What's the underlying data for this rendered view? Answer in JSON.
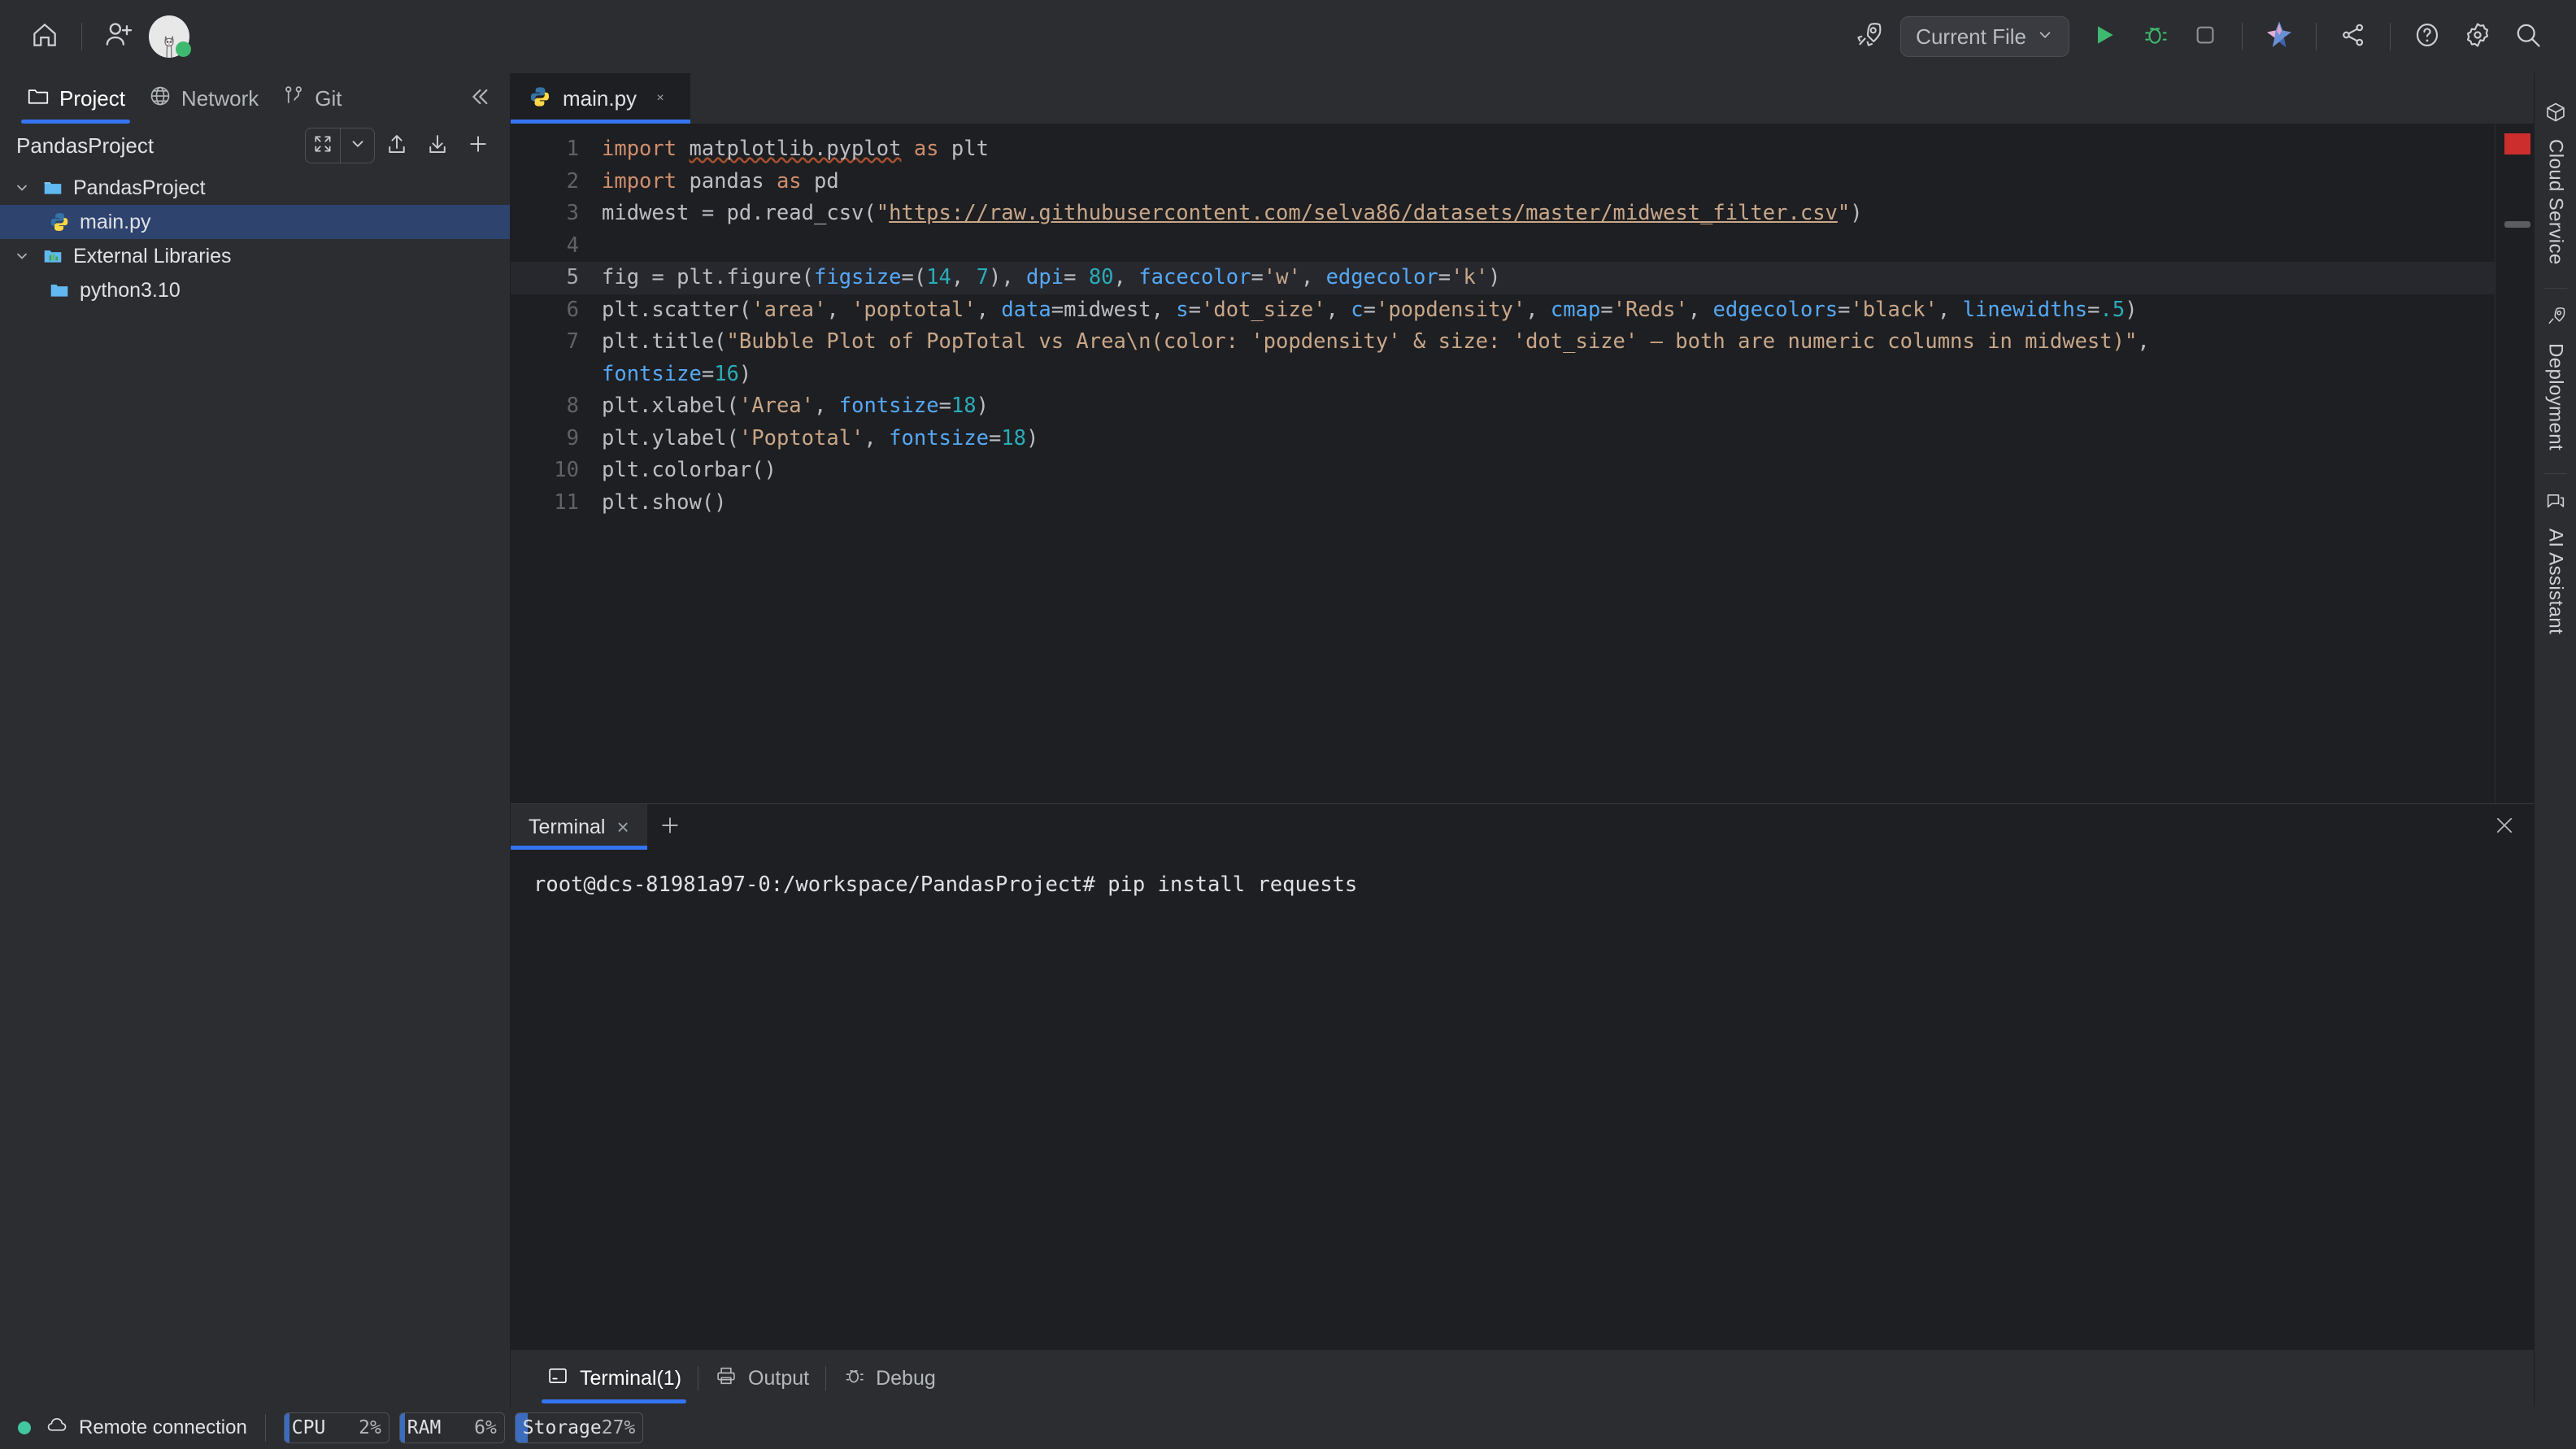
{
  "toolbar": {
    "home_icon": "home-icon",
    "add_user_icon": "add-user-icon",
    "avatar_icon": "user-avatar",
    "rocket_icon": "rocket-icon",
    "run_config": "Current File",
    "run_icon": "run-icon",
    "debug_icon": "debug-icon",
    "stop_icon": "stop-icon",
    "ai_icon": "ai-star-icon",
    "share_icon": "share-icon",
    "help_icon": "help-icon",
    "settings_icon": "settings-gear-icon",
    "search_icon": "search-icon"
  },
  "left_panel": {
    "tabs": [
      {
        "label": "Project",
        "icon": "folder-icon",
        "active": true
      },
      {
        "label": "Network",
        "icon": "globe-icon",
        "active": false
      },
      {
        "label": "Git",
        "icon": "git-branch-icon",
        "active": false
      }
    ],
    "collapse_icon": "collapse-panel-icon",
    "title": "PandasProject",
    "actions": {
      "collapse_all_icon": "collapse-all-icon",
      "chevron_down_icon": "chevron-down-icon",
      "upload_icon": "upload-icon",
      "download_icon": "download-icon",
      "add_icon": "plus-icon"
    },
    "tree": [
      {
        "label": "PandasProject",
        "icon": "folder-icon",
        "depth": 0,
        "expanded": true,
        "selected": false
      },
      {
        "label": "main.py",
        "icon": "python-file-icon",
        "depth": 1,
        "expanded": null,
        "selected": true
      },
      {
        "label": "External Libraries",
        "icon": "libraries-icon",
        "depth": 0,
        "expanded": true,
        "selected": false
      },
      {
        "label": "python3.10",
        "icon": "folder-icon",
        "depth": 1,
        "expanded": null,
        "selected": false
      }
    ]
  },
  "editor": {
    "tab": {
      "label": "main.py",
      "icon": "python-file-icon",
      "close": "×"
    },
    "current_line": 5,
    "lines": [
      {
        "num": "1",
        "tokens": [
          {
            "t": "import ",
            "c": "k"
          },
          {
            "t": "matplotlib.pyplot",
            "c": "squig"
          },
          {
            "t": " ",
            "c": "p"
          },
          {
            "t": "as",
            "c": "k"
          },
          {
            "t": " plt",
            "c": "p"
          }
        ]
      },
      {
        "num": "2",
        "tokens": [
          {
            "t": "import ",
            "c": "k"
          },
          {
            "t": "pandas ",
            "c": "p"
          },
          {
            "t": "as",
            "c": "k"
          },
          {
            "t": " pd",
            "c": "p"
          }
        ]
      },
      {
        "num": "3",
        "tokens": [
          {
            "t": "midwest = pd.read_csv(",
            "c": "p"
          },
          {
            "t": "\"",
            "c": "s"
          },
          {
            "t": "https://raw.githubusercontent.com/selva86/datasets/master/midwest_filter.csv",
            "c": "link"
          },
          {
            "t": "\"",
            "c": "s"
          },
          {
            "t": ")",
            "c": "p"
          }
        ]
      },
      {
        "num": "4",
        "tokens": []
      },
      {
        "num": "5",
        "tokens": [
          {
            "t": "fig = plt.figure(",
            "c": "p"
          },
          {
            "t": "figsize",
            "c": "a"
          },
          {
            "t": "=(",
            "c": "p"
          },
          {
            "t": "14",
            "c": "n"
          },
          {
            "t": ", ",
            "c": "p"
          },
          {
            "t": "7",
            "c": "n"
          },
          {
            "t": "), ",
            "c": "p"
          },
          {
            "t": "dpi",
            "c": "a"
          },
          {
            "t": "= ",
            "c": "p"
          },
          {
            "t": "80",
            "c": "n"
          },
          {
            "t": ", ",
            "c": "p"
          },
          {
            "t": "facecolor",
            "c": "a"
          },
          {
            "t": "=",
            "c": "p"
          },
          {
            "t": "'w'",
            "c": "s"
          },
          {
            "t": ", ",
            "c": "p"
          },
          {
            "t": "edgecolor",
            "c": "a"
          },
          {
            "t": "=",
            "c": "p"
          },
          {
            "t": "'k'",
            "c": "s"
          },
          {
            "t": ")",
            "c": "p"
          }
        ]
      },
      {
        "num": "6",
        "tokens": [
          {
            "t": "plt.scatter(",
            "c": "p"
          },
          {
            "t": "'area'",
            "c": "s"
          },
          {
            "t": ", ",
            "c": "p"
          },
          {
            "t": "'poptotal'",
            "c": "s"
          },
          {
            "t": ", ",
            "c": "p"
          },
          {
            "t": "data",
            "c": "a"
          },
          {
            "t": "=midwest, ",
            "c": "p"
          },
          {
            "t": "s",
            "c": "a"
          },
          {
            "t": "=",
            "c": "p"
          },
          {
            "t": "'dot_size'",
            "c": "s"
          },
          {
            "t": ", ",
            "c": "p"
          },
          {
            "t": "c",
            "c": "a"
          },
          {
            "t": "=",
            "c": "p"
          },
          {
            "t": "'popdensity'",
            "c": "s"
          },
          {
            "t": ", ",
            "c": "p"
          },
          {
            "t": "cmap",
            "c": "a"
          },
          {
            "t": "=",
            "c": "p"
          },
          {
            "t": "'Reds'",
            "c": "s"
          },
          {
            "t": ", ",
            "c": "p"
          },
          {
            "t": "edgecolors",
            "c": "a"
          },
          {
            "t": "=",
            "c": "p"
          },
          {
            "t": "'black'",
            "c": "s"
          },
          {
            "t": ", ",
            "c": "p"
          },
          {
            "t": "linewidths",
            "c": "a"
          },
          {
            "t": "=",
            "c": "p"
          },
          {
            "t": ".5",
            "c": "n"
          },
          {
            "t": ")",
            "c": "p"
          }
        ]
      },
      {
        "num": "7",
        "tokens": [
          {
            "t": "plt.title(",
            "c": "p"
          },
          {
            "t": "\"Bubble Plot of PopTotal vs Area\\n(color: 'popdensity' & size: 'dot_size' — both are numeric columns in midwest)\"",
            "c": "s"
          },
          {
            "t": ", ",
            "c": "p"
          },
          {
            "t": "\n",
            "c": "p"
          },
          {
            "t": "fontsize",
            "c": "a"
          },
          {
            "t": "=",
            "c": "p"
          },
          {
            "t": "16",
            "c": "n"
          },
          {
            "t": ")",
            "c": "p"
          }
        ]
      },
      {
        "num": "8",
        "tokens": [
          {
            "t": "plt.xlabel(",
            "c": "p"
          },
          {
            "t": "'Area'",
            "c": "s"
          },
          {
            "t": ", ",
            "c": "p"
          },
          {
            "t": "fontsize",
            "c": "a"
          },
          {
            "t": "=",
            "c": "p"
          },
          {
            "t": "18",
            "c": "n"
          },
          {
            "t": ")",
            "c": "p"
          }
        ]
      },
      {
        "num": "9",
        "tokens": [
          {
            "t": "plt.ylabel(",
            "c": "p"
          },
          {
            "t": "'Poptotal'",
            "c": "s"
          },
          {
            "t": ", ",
            "c": "p"
          },
          {
            "t": "fontsize",
            "c": "a"
          },
          {
            "t": "=",
            "c": "p"
          },
          {
            "t": "18",
            "c": "n"
          },
          {
            "t": ")",
            "c": "p"
          }
        ]
      },
      {
        "num": "10",
        "tokens": [
          {
            "t": "plt.colorbar()",
            "c": "p"
          }
        ]
      },
      {
        "num": "11",
        "tokens": [
          {
            "t": "plt.show()",
            "c": "p"
          }
        ]
      }
    ]
  },
  "terminal": {
    "tab": {
      "label": "Terminal",
      "close": "×"
    },
    "add_icon": "plus-icon",
    "close_icon": "close-icon",
    "lines": [
      "root@dcs-81981a97-0:/workspace/PandasProject# pip install requests"
    ]
  },
  "toolwindow_bar": [
    {
      "label": "Terminal(1)",
      "icon": "terminal-icon",
      "active": true
    },
    {
      "label": "Output",
      "icon": "output-printer-icon",
      "active": false
    },
    {
      "label": "Debug",
      "icon": "debug-bug-icon",
      "active": false
    }
  ],
  "right_bar": [
    {
      "label": "Cloud Service",
      "icon": "cube-icon"
    },
    {
      "label": "Deployment",
      "icon": "rocket-icon"
    },
    {
      "label": "AI Assistant",
      "icon": "chat-bubble-icon"
    }
  ],
  "status_bar": {
    "remote_label": "Remote connection",
    "remote_icon": "cloud-icon",
    "status_dot_color": "#42c6a0",
    "gauges": [
      {
        "label": "CPU",
        "value": "2%",
        "percent": 2
      },
      {
        "label": "RAM",
        "value": "6%",
        "percent": 6
      },
      {
        "label": "Storage",
        "value": "27%",
        "percent": 27
      }
    ]
  },
  "colors": {
    "accent": "#3574f0",
    "run_green": "#3fb96f",
    "error_red": "#cc2e2e",
    "selection_blue": "#2e436e"
  }
}
